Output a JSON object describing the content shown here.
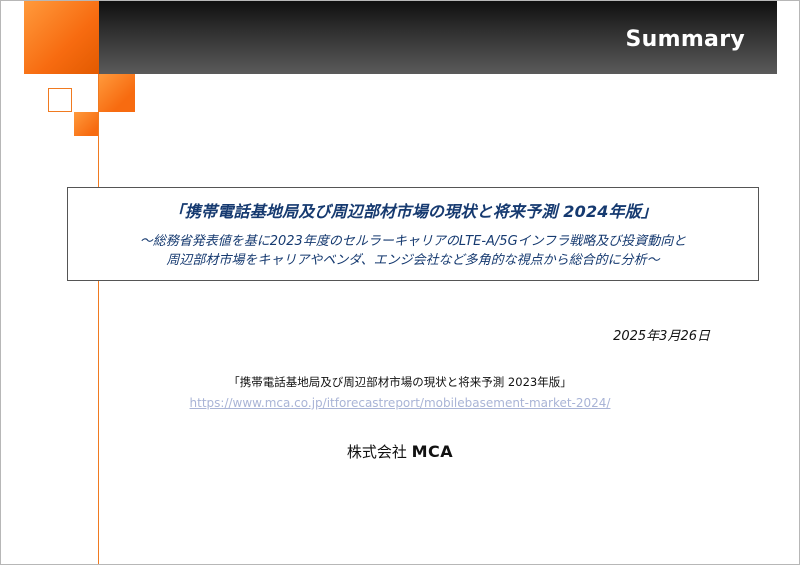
{
  "header": {
    "title": "Summary"
  },
  "report": {
    "title": "「携帯電話基地局及び周辺部材市場の現状と将来予測 2024年版」",
    "subtitle_line1": "～総務省発表値を基に2023年度のセルラーキャリアのLTE-A/5Gインフラ戦略及び投資動向と",
    "subtitle_line2": "周辺部材市場をキャリアやベンダ、エンジ会社など多角的な視点から総合的に分析～"
  },
  "date": "2025年3月26日",
  "reference": {
    "name": "「携帯電話基地局及び周辺部材市場の現状と将来予測 2023年版」",
    "url": "https://www.mca.co.jp/itforecastreport/mobilebasement-market-2024/"
  },
  "company": {
    "prefix": "株式会社",
    "name": "MCA"
  },
  "colors": {
    "accent_orange": "#f76b10",
    "header_dark": "#2f2f2f",
    "title_navy": "#163a70",
    "link_light": "#a9b4d6"
  }
}
